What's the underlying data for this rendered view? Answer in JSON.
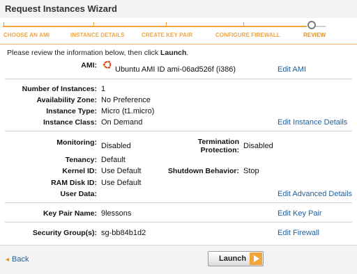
{
  "window": {
    "title": "Request Instances Wizard"
  },
  "steps": [
    {
      "label": "CHOOSE AN AMI"
    },
    {
      "label": "INSTANCE DETAILS"
    },
    {
      "label": "CREATE KEY PAIR"
    },
    {
      "label": "CONFIGURE FIREWALL"
    },
    {
      "label": "REVIEW"
    }
  ],
  "intro": {
    "text": "Please review the information below, then click ",
    "strong": "Launch",
    "end": "."
  },
  "ami": {
    "label": "AMI:",
    "value": "Ubuntu AMI ID ami-06ad526f (i386)",
    "icon": "ubuntu-logo-icon",
    "edit": "Edit AMI"
  },
  "instance": {
    "number_label": "Number of Instances:",
    "number_value": "1",
    "zone_label": "Availability Zone:",
    "zone_value": "No Preference",
    "type_label": "Instance Type:",
    "type_value": "Micro (t1.micro)",
    "class_label": "Instance Class:",
    "class_value": "On Demand",
    "edit": "Edit Instance Details"
  },
  "advanced": {
    "monitoring_label": "Monitoring:",
    "monitoring_value": "Disabled",
    "termination_label_1": "Termination",
    "termination_label_2": "Protection:",
    "termination_value": "Disabled",
    "tenancy_label": "Tenancy:",
    "tenancy_value": "Default",
    "kernel_label": "Kernel ID:",
    "kernel_value": "Use Default",
    "shutdown_label": "Shutdown Behavior:",
    "shutdown_value": "Stop",
    "ramdisk_label": "RAM Disk ID:",
    "ramdisk_value": "Use Default",
    "userdata_label": "User Data:",
    "userdata_value": "",
    "edit": "Edit Advanced Details"
  },
  "keypair": {
    "label": "Key Pair Name:",
    "value": "9lessons",
    "edit": "Edit Key Pair"
  },
  "security": {
    "label": "Security Group(s):",
    "value": "sg-bb84b1d2",
    "edit": "Edit Firewall"
  },
  "footer": {
    "back": "Back",
    "launch": "Launch"
  },
  "colors": {
    "accent": "#f2a33a",
    "link": "#1b5f9e"
  }
}
